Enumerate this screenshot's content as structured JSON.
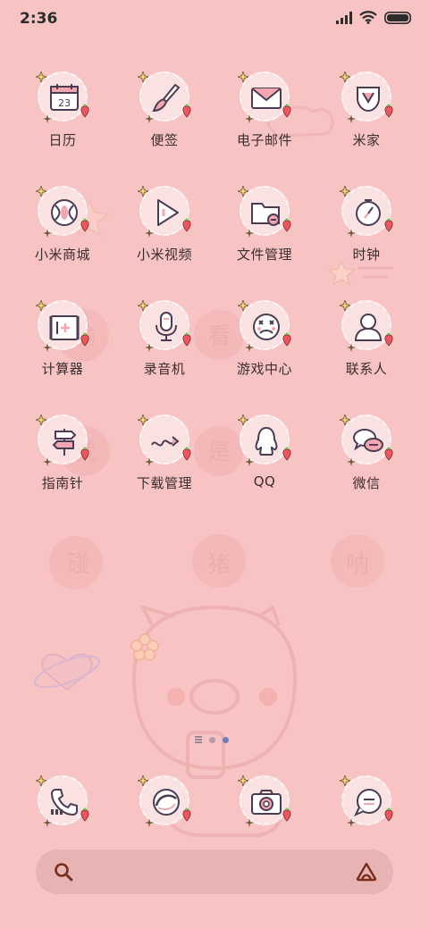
{
  "status_bar": {
    "time": "2:36"
  },
  "apps": [
    {
      "label": "日历",
      "icon": "calendar-icon",
      "calendar_day": "23"
    },
    {
      "label": "便签",
      "icon": "brush-icon"
    },
    {
      "label": "电子邮件",
      "icon": "mail-icon"
    },
    {
      "label": "米家",
      "icon": "mijia-icon"
    },
    {
      "label": "小米商城",
      "icon": "mi-store-icon"
    },
    {
      "label": "小米视频",
      "icon": "video-icon"
    },
    {
      "label": "文件管理",
      "icon": "folder-icon"
    },
    {
      "label": "时钟",
      "icon": "clock-icon"
    },
    {
      "label": "计算器",
      "icon": "calculator-icon"
    },
    {
      "label": "录音机",
      "icon": "microphone-icon"
    },
    {
      "label": "游戏中心",
      "icon": "game-face-icon"
    },
    {
      "label": "联系人",
      "icon": "contact-icon"
    },
    {
      "label": "指南针",
      "icon": "signpost-icon"
    },
    {
      "label": "下载管理",
      "icon": "download-icon"
    },
    {
      "label": "QQ",
      "icon": "qq-icon"
    },
    {
      "label": "微信",
      "icon": "wechat-icon"
    }
  ],
  "dock": [
    {
      "name": "phone",
      "icon": "phone-icon"
    },
    {
      "name": "browser",
      "icon": "browser-icon"
    },
    {
      "name": "camera",
      "icon": "camera-icon"
    },
    {
      "name": "messages",
      "icon": "message-icon"
    }
  ],
  "search": {
    "placeholder": ""
  },
  "pager": {
    "pages": 2,
    "current": 2
  },
  "colors": {
    "background": "#f7c3c3",
    "icon_bg": "#fbe2e2",
    "stroke": "#4a3c52",
    "search_bg": "#e7b3b3",
    "accent_dot": "#6b7fc4"
  }
}
